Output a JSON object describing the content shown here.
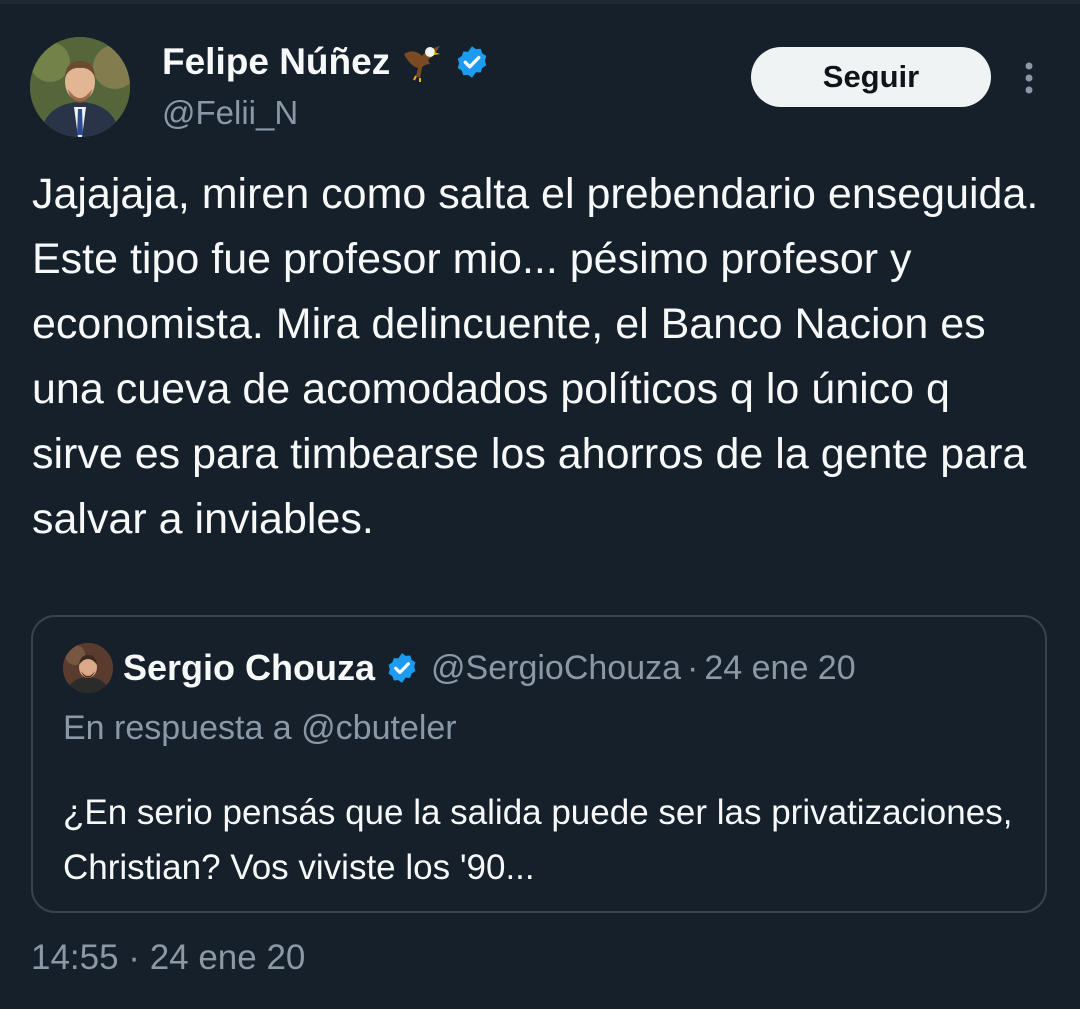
{
  "tweet": {
    "author": {
      "name": "Felipe Núñez",
      "handle": "@Felii_N",
      "avatar_icon": "avatar-photo",
      "name_emoji_icon": "eagle-icon",
      "verified_icon": "verified-badge-icon"
    },
    "follow_label": "Seguir",
    "more_icon": "more-options-icon",
    "text": "Jajajaja, miren como salta el prebendario enseguida. Este tipo fue profesor mio... pésimo profesor y economista. Mira delincuente, el Banco Nacion es una cueva de acomodados políticos q lo único q sirve es para timbearse los ahorros de la gente para salvar a inviables.",
    "timestamp": "14:55 · 24 ene 20"
  },
  "quoted_tweet": {
    "name": "Sergio Chouza",
    "handle": "@SergioChouza",
    "separator": "·",
    "date": "24 ene 20",
    "reply_context": "En respuesta a @cbuteler",
    "text": "¿En serio pensás que la salida puede ser las privatizaciones, Christian? Vos viviste los '90..."
  },
  "colors": {
    "background": "#15202b",
    "text_primary": "#f7f9f9",
    "text_secondary": "#8b98a5",
    "verified_blue": "#1d9bf0",
    "border": "#38444d",
    "button_bg": "#eff3f4"
  }
}
